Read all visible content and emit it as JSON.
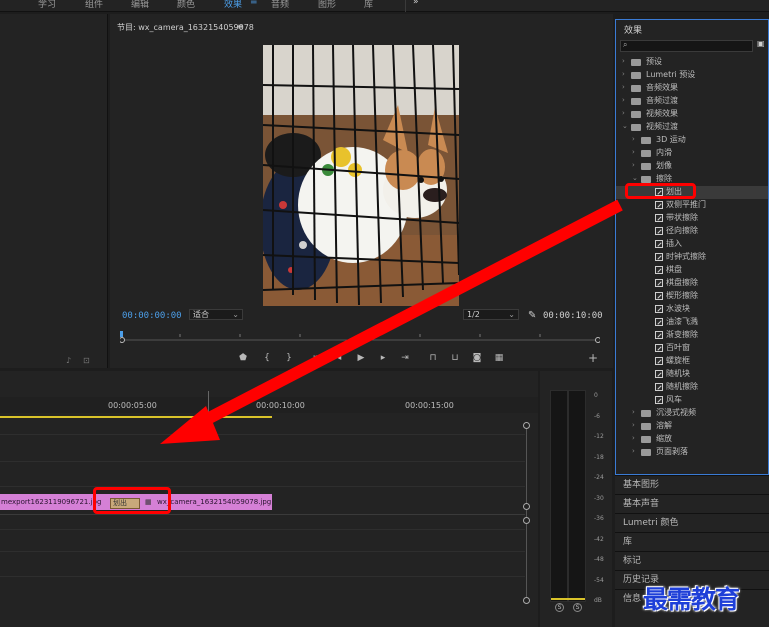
{
  "workspace_tabs": [
    "学习",
    "组件",
    "编辑",
    "颜色",
    "效果",
    "音频",
    "图形",
    "库"
  ],
  "workspace_active": "效果",
  "workspace_more": "»",
  "program": {
    "title": "节目: wx_camera_1632154059078",
    "timecode_current": "00:00:00:00",
    "fit_label": "适合",
    "resolution_label": "1/2",
    "timecode_duration": "00:00:10:00"
  },
  "effects": {
    "header": "效果",
    "tree": [
      {
        "label": "预设",
        "kind": "folder",
        "level": 0,
        "expanded": false
      },
      {
        "label": "Lumetri 预设",
        "kind": "folder",
        "level": 0,
        "expanded": false
      },
      {
        "label": "音频效果",
        "kind": "folder",
        "level": 0,
        "expanded": false
      },
      {
        "label": "音频过渡",
        "kind": "folder",
        "level": 0,
        "expanded": false
      },
      {
        "label": "视频效果",
        "kind": "folder",
        "level": 0,
        "expanded": false
      },
      {
        "label": "视频过渡",
        "kind": "folder",
        "level": 0,
        "expanded": true
      },
      {
        "label": "3D 运动",
        "kind": "folder",
        "level": 1,
        "expanded": false
      },
      {
        "label": "内滑",
        "kind": "folder",
        "level": 1,
        "expanded": false
      },
      {
        "label": "划像",
        "kind": "folder",
        "level": 1,
        "expanded": false
      },
      {
        "label": "擦除",
        "kind": "folder",
        "level": 1,
        "expanded": true
      },
      {
        "label": "划出",
        "kind": "effect",
        "level": 2,
        "selected": true
      },
      {
        "label": "双侧平推门",
        "kind": "effect",
        "level": 2
      },
      {
        "label": "带状擦除",
        "kind": "effect",
        "level": 2
      },
      {
        "label": "径向擦除",
        "kind": "effect",
        "level": 2
      },
      {
        "label": "插入",
        "kind": "effect",
        "level": 2
      },
      {
        "label": "时钟式擦除",
        "kind": "effect",
        "level": 2
      },
      {
        "label": "棋盘",
        "kind": "effect",
        "level": 2
      },
      {
        "label": "棋盘擦除",
        "kind": "effect",
        "level": 2
      },
      {
        "label": "楔形擦除",
        "kind": "effect",
        "level": 2
      },
      {
        "label": "水波块",
        "kind": "effect",
        "level": 2
      },
      {
        "label": "油漆飞溅",
        "kind": "effect",
        "level": 2
      },
      {
        "label": "渐变擦除",
        "kind": "effect",
        "level": 2
      },
      {
        "label": "百叶窗",
        "kind": "effect",
        "level": 2
      },
      {
        "label": "螺旋框",
        "kind": "effect",
        "level": 2
      },
      {
        "label": "随机块",
        "kind": "effect",
        "level": 2
      },
      {
        "label": "随机擦除",
        "kind": "effect",
        "level": 2
      },
      {
        "label": "风车",
        "kind": "effect",
        "level": 2
      },
      {
        "label": "沉浸式视频",
        "kind": "folder",
        "level": 1,
        "expanded": false
      },
      {
        "label": "溶解",
        "kind": "folder",
        "level": 1,
        "expanded": false
      },
      {
        "label": "缩放",
        "kind": "folder",
        "level": 1,
        "expanded": false
      },
      {
        "label": "页面剥落",
        "kind": "folder",
        "level": 1,
        "expanded": false
      }
    ]
  },
  "side_panels": [
    "基本图形",
    "基本声音",
    "Lumetri 颜色",
    "库",
    "标记",
    "历史记录",
    "信息"
  ],
  "timeline": {
    "ruler": [
      "00:00:05:00",
      "00:00:10:00",
      "00:00:15:00"
    ],
    "clip_a": "mexport1623119096721.jpg",
    "transition_label": "划出",
    "clip_b": "wx_camera_1632154059078.jpg"
  },
  "meters": {
    "ticks": [
      "0",
      "-6",
      "-12",
      "-18",
      "-24",
      "-30",
      "-36",
      "-42",
      "-48",
      "-54",
      "dB"
    ],
    "solo": [
      "S",
      "S"
    ]
  },
  "watermark": "最需教育",
  "colors": {
    "accent": "#4c9ee8",
    "clip": "#d580d6",
    "annotation": "#ff0000",
    "watermark": "#1e3fd8"
  }
}
